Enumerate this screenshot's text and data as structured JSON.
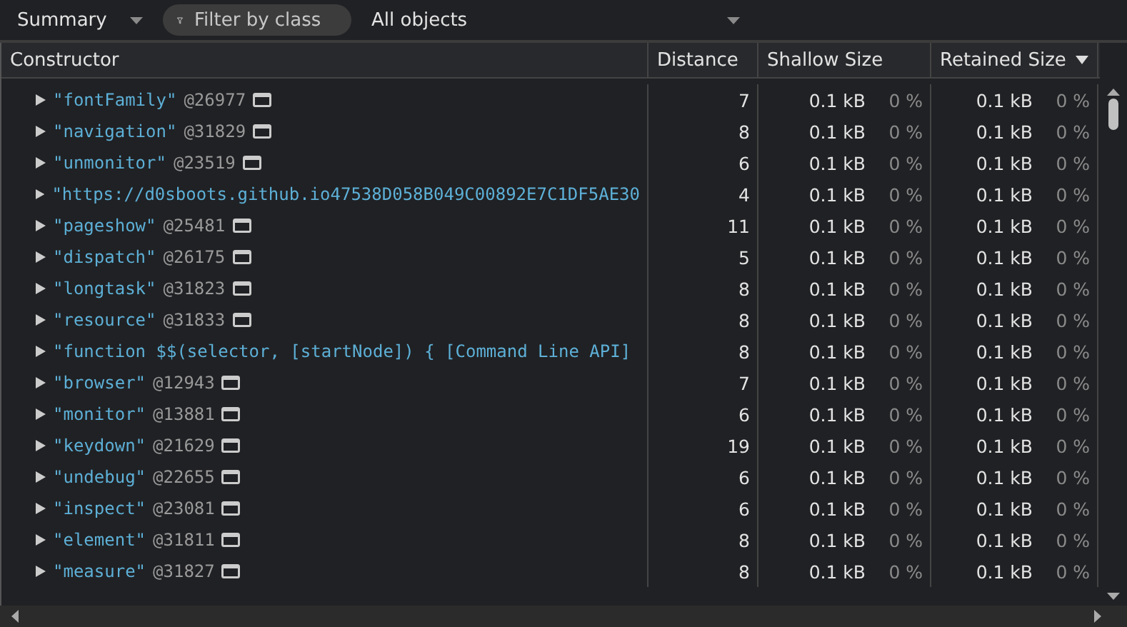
{
  "toolbar": {
    "view": "Summary",
    "filter": {
      "placeholder": "Filter by class"
    },
    "scope": "All objects"
  },
  "columns": [
    {
      "label": "Constructor",
      "sorted": false
    },
    {
      "label": "Distance",
      "sorted": false
    },
    {
      "label": "Shallow Size",
      "sorted": false
    },
    {
      "label": "Retained Size",
      "sorted": true
    }
  ],
  "rows": [
    {
      "name": "\"fontFamily\"",
      "id": "@26977",
      "distance": "7",
      "shallow": "0.1 kB",
      "shallow_pct": "0 %",
      "retained": "0.1 kB",
      "retained_pct": "0 %"
    },
    {
      "name": "\"navigation\"",
      "id": "@31829",
      "distance": "8",
      "shallow": "0.1 kB",
      "shallow_pct": "0 %",
      "retained": "0.1 kB",
      "retained_pct": "0 %"
    },
    {
      "name": "\"unmonitor\"",
      "id": "@23519",
      "distance": "6",
      "shallow": "0.1 kB",
      "shallow_pct": "0 %",
      "retained": "0.1 kB",
      "retained_pct": "0 %"
    },
    {
      "name": "\"https://d0sboots.github.io47538D058B049C00892E7C1DF5AE30",
      "distance": "4",
      "shallow": "0.1 kB",
      "shallow_pct": "0 %",
      "retained": "0.1 kB",
      "retained_pct": "0 %"
    },
    {
      "name": "\"pageshow\"",
      "id": "@25481",
      "distance": "11",
      "shallow": "0.1 kB",
      "shallow_pct": "0 %",
      "retained": "0.1 kB",
      "retained_pct": "0 %"
    },
    {
      "name": "\"dispatch\"",
      "id": "@26175",
      "distance": "5",
      "shallow": "0.1 kB",
      "shallow_pct": "0 %",
      "retained": "0.1 kB",
      "retained_pct": "0 %"
    },
    {
      "name": "\"longtask\"",
      "id": "@31823",
      "distance": "8",
      "shallow": "0.1 kB",
      "shallow_pct": "0 %",
      "retained": "0.1 kB",
      "retained_pct": "0 %"
    },
    {
      "name": "\"resource\"",
      "id": "@31833",
      "distance": "8",
      "shallow": "0.1 kB",
      "shallow_pct": "0 %",
      "retained": "0.1 kB",
      "retained_pct": "0 %"
    },
    {
      "name": "\"function $$(selector, [startNode]) { [Command Line API]",
      "distance": "8",
      "shallow": "0.1 kB",
      "shallow_pct": "0 %",
      "retained": "0.1 kB",
      "retained_pct": "0 %"
    },
    {
      "name": "\"browser\"",
      "id": "@12943",
      "distance": "7",
      "shallow": "0.1 kB",
      "shallow_pct": "0 %",
      "retained": "0.1 kB",
      "retained_pct": "0 %"
    },
    {
      "name": "\"monitor\"",
      "id": "@13881",
      "distance": "6",
      "shallow": "0.1 kB",
      "shallow_pct": "0 %",
      "retained": "0.1 kB",
      "retained_pct": "0 %"
    },
    {
      "name": "\"keydown\"",
      "id": "@21629",
      "distance": "19",
      "shallow": "0.1 kB",
      "shallow_pct": "0 %",
      "retained": "0.1 kB",
      "retained_pct": "0 %"
    },
    {
      "name": "\"undebug\"",
      "id": "@22655",
      "distance": "6",
      "shallow": "0.1 kB",
      "shallow_pct": "0 %",
      "retained": "0.1 kB",
      "retained_pct": "0 %"
    },
    {
      "name": "\"inspect\"",
      "id": "@23081",
      "distance": "6",
      "shallow": "0.1 kB",
      "shallow_pct": "0 %",
      "retained": "0.1 kB",
      "retained_pct": "0 %"
    },
    {
      "name": "\"element\"",
      "id": "@31811",
      "distance": "8",
      "shallow": "0.1 kB",
      "shallow_pct": "0 %",
      "retained": "0.1 kB",
      "retained_pct": "0 %"
    },
    {
      "name": "\"measure\"",
      "id": "@31827",
      "distance": "8",
      "shallow": "0.1 kB",
      "shallow_pct": "0 %",
      "retained": "0.1 kB",
      "retained_pct": "0 %"
    }
  ]
}
